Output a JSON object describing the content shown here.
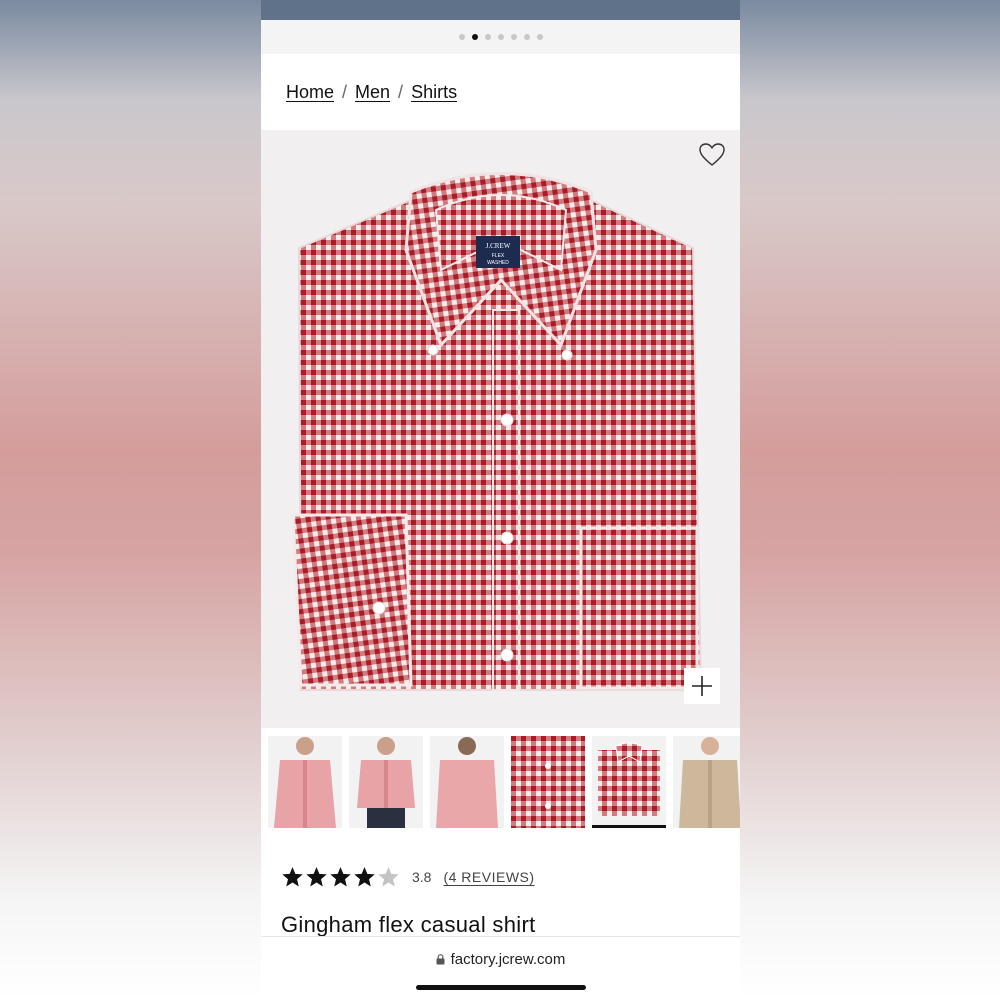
{
  "carousel": {
    "dot_count": 7,
    "active_index": 1
  },
  "breadcrumb": {
    "items": [
      "Home",
      "Men",
      "Shirts"
    ],
    "separator": "/"
  },
  "product": {
    "title": "Gingham flex casual shirt",
    "rating": "3.8",
    "rating_fraction": 0.76,
    "reviews_label": "(4 REVIEWS)",
    "label_brand": "J.CREW",
    "label_line1": "FLEX",
    "label_line2": "WASHED"
  },
  "thumbnails": {
    "count": 6,
    "selected_index": 4
  },
  "icons": {
    "favorite": "heart-outline-icon",
    "zoom": "plus-icon",
    "secure": "lock-icon",
    "star": "star-icon"
  },
  "colors": {
    "gingham_red": "#b8232c",
    "gingham_light": "#f6ecec",
    "pink_shirt": "#e7a3a6",
    "topbar": "#5f7289"
  },
  "browser": {
    "url": "factory.jcrew.com"
  }
}
